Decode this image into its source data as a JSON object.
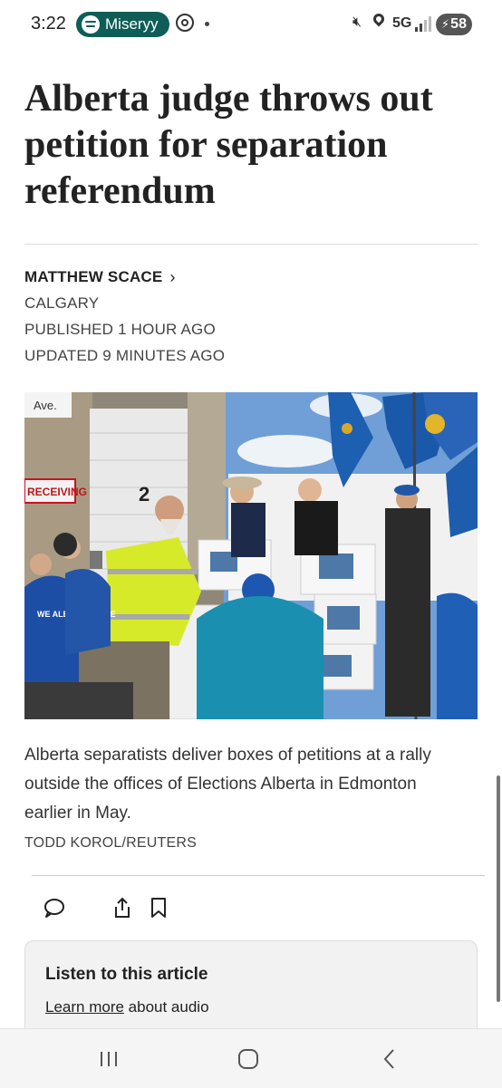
{
  "status_bar": {
    "time": "3:22",
    "media_app": "Miseryy",
    "network": "5G",
    "battery": "58"
  },
  "article": {
    "headline": "Alberta judge throws out petition for separation referendum",
    "author": "MATTHEW SCACE",
    "location": "CALGARY",
    "published": "PUBLISHED 1 HOUR AGO",
    "updated": "UPDATED 9 MINUTES AGO",
    "photo": {
      "sign_receiving": "RECEIVING",
      "door_number": "2",
      "sign_top": "Ave.",
      "shirt_text": "WE ALBERTA RACE"
    },
    "caption": "Alberta separatists deliver boxes of petitions at a rally outside the offices of Elections Alberta in Edmonton earlier in May.",
    "credit": "TODD KOROL/REUTERS"
  },
  "actions": {
    "icons": [
      "comment-icon",
      "share-icon",
      "bookmark-icon"
    ]
  },
  "listen": {
    "title": "Listen to this article",
    "link": "Learn more",
    "suffix": " about audio"
  },
  "colors": {
    "media_pill": "#0f5d57",
    "headline": "#222222",
    "card_bg": "#f2f2f2"
  }
}
